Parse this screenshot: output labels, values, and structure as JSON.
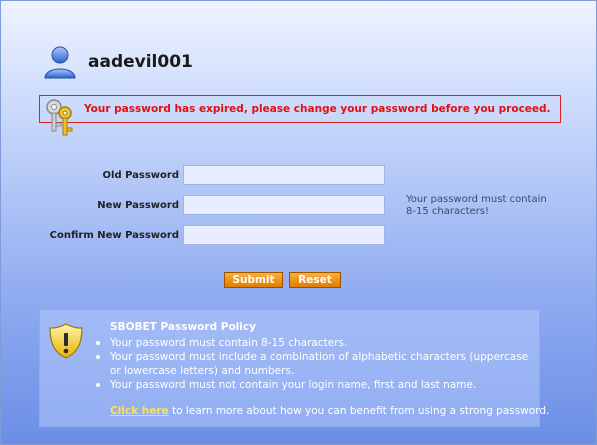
{
  "user": {
    "name": "aadevil001",
    "icon": "user-icon"
  },
  "alert": {
    "icon": "keys-icon",
    "message": "Your password has expired, please change your password before you proceed.",
    "color": "#e01010"
  },
  "form": {
    "old_password_label": "Old Password",
    "new_password_label": "New Password",
    "confirm_password_label": "Confirm New Password",
    "old_password_value": "",
    "new_password_value": "",
    "confirm_password_value": "",
    "hint": "Your password must contain 8-15 characters!"
  },
  "buttons": {
    "submit_label": "Submit",
    "reset_label": "Reset",
    "accent": "#e07c00"
  },
  "policy": {
    "icon": "warning-shield-icon",
    "title": "SBOBET Password Policy",
    "items": [
      "Your password must contain 8-15 characters.",
      "Your password must include a combination of alphabetic characters (uppercase or lowercase letters) and numbers.",
      "Your password must not contain your login name, first and last name."
    ],
    "link_label": "Click here",
    "link_suffix": " to learn more about how you can benefit from using a strong password.",
    "link_color": "#ffe24a"
  }
}
